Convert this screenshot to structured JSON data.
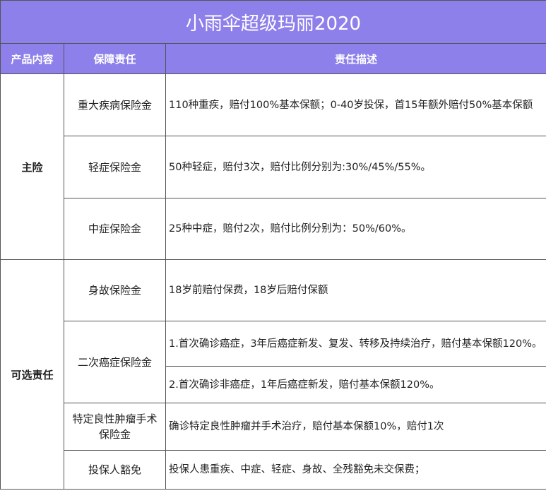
{
  "title": "小雨伞超级玛丽2020",
  "headers": {
    "product": "产品内容",
    "coverage": "保障责任",
    "description": "责任描述"
  },
  "categories": {
    "main": "主险",
    "optional": "可选责任"
  },
  "rows": {
    "critical": {
      "item": "重大疾病保险金",
      "desc": "110种重疾，赔付100%基本保额；0-40岁投保，首15年额外赔付50%基本保额"
    },
    "mild": {
      "item": "轻症保险金",
      "desc": "50种轻症，赔付3次，赔付比例分别为:30%/45%/55%。"
    },
    "moderate": {
      "item": "中症保险金",
      "desc": "25种中症，赔付2次，赔付比例分别为：50%/60%。"
    },
    "death": {
      "item": "身故保险金",
      "desc": "18岁前赔付保费，18岁后赔付保额"
    },
    "second_cancer": {
      "item": "二次癌症保险金",
      "desc1": "1.首次确诊癌症，3年后癌症新发、复发、转移及持续治疗，赔付基本保额120%。",
      "desc2": "2.首次确诊非癌症，1年后癌症新发，赔付基本保额120%。"
    },
    "tumor": {
      "item": "特定良性肿瘤手术保险金",
      "desc": "确诊特定良性肿瘤并手术治疗，赔付基本保额10%，赔付1次"
    },
    "waiver": {
      "item": "投保人豁免",
      "desc": "投保人患重疾、中症、轻症、身故、全残豁免未交保费；"
    }
  }
}
